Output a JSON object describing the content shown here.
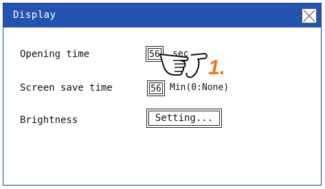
{
  "window": {
    "title": "Display"
  },
  "rows": [
    {
      "label": "Opening time",
      "value": "56",
      "unit": "sec"
    },
    {
      "label": "Screen save time",
      "value": "56",
      "unit": "Min(0:None)"
    },
    {
      "label": "Brightness",
      "button_label": "Setting..."
    }
  ],
  "annotation": {
    "step": "1.",
    "color": "#e87722"
  },
  "icons": {
    "close": "close-icon",
    "pointer": "pointing-hand-icon"
  },
  "colors": {
    "titlebar": "#2553b0"
  }
}
